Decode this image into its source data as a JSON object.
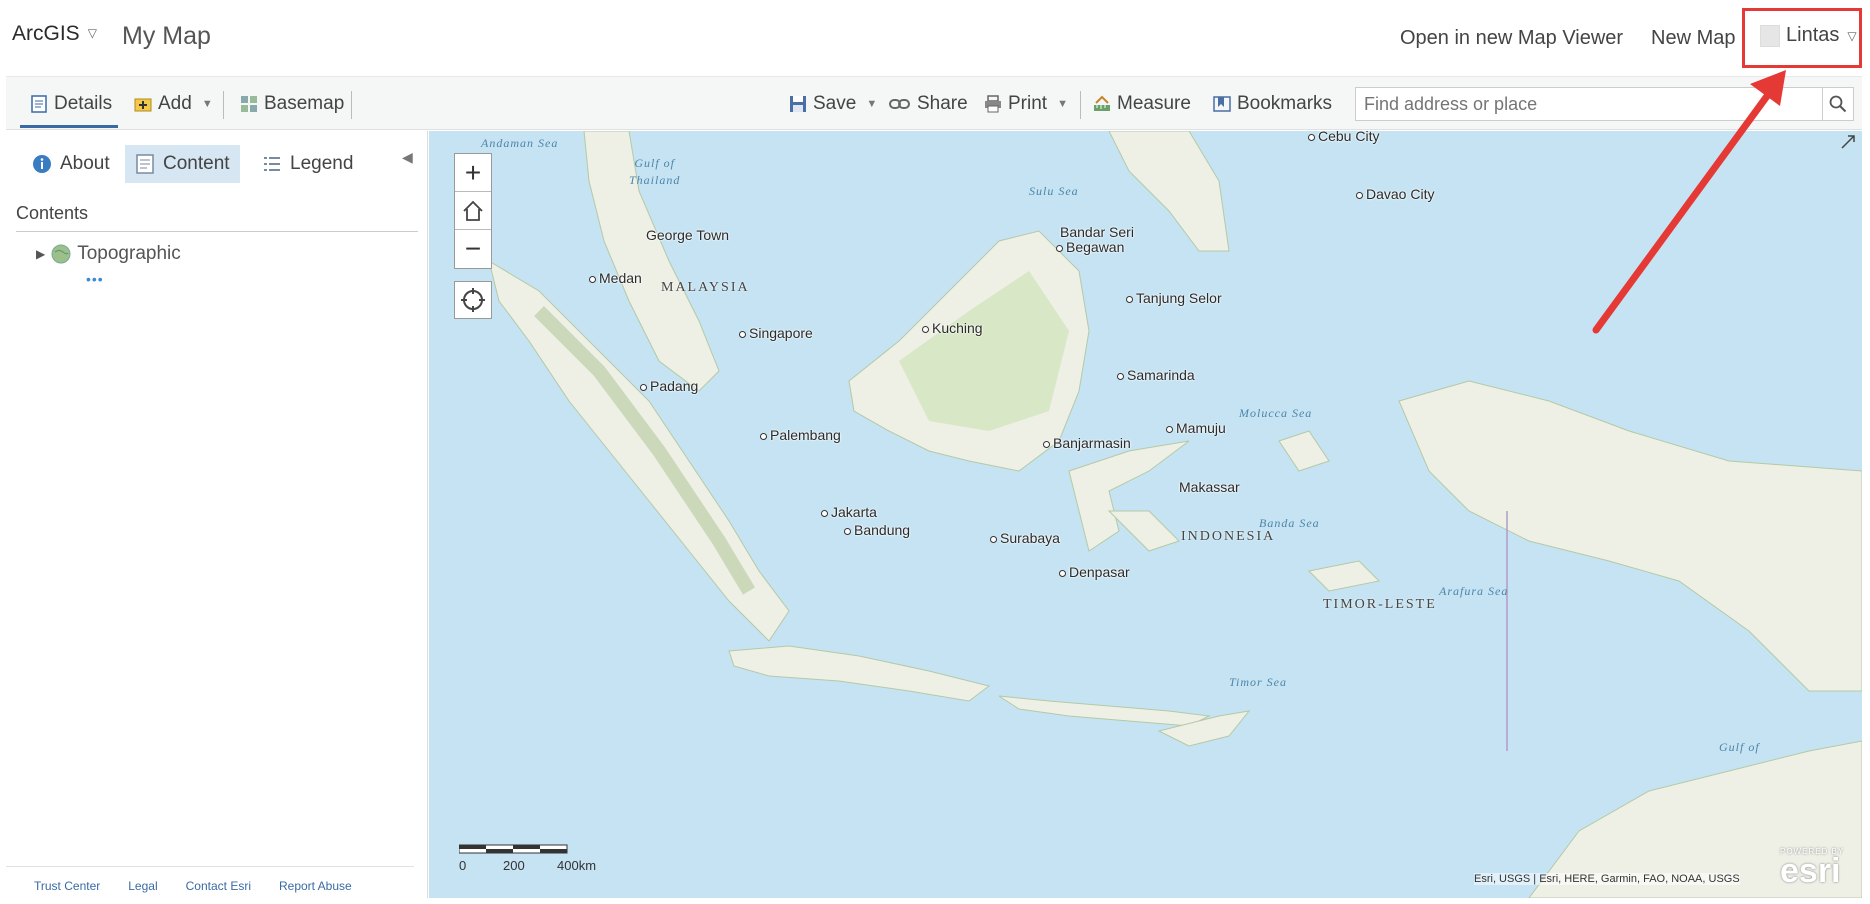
{
  "header": {
    "brand": "ArcGIS",
    "map_title": "My Map",
    "open_viewer": "Open in new Map Viewer",
    "new_map": "New Map",
    "user_name": "Lintas"
  },
  "toolbar": {
    "details": "Details",
    "add": "Add",
    "basemap": "Basemap",
    "save": "Save",
    "share": "Share",
    "print": "Print",
    "measure": "Measure",
    "bookmarks": "Bookmarks",
    "search_placeholder": "Find address or place"
  },
  "panel": {
    "tabs": {
      "about": "About",
      "content": "Content",
      "legend": "Legend"
    },
    "contents_title": "Contents",
    "layer_name": "Topographic",
    "footer": [
      "Trust Center",
      "Legal",
      "Contact Esri",
      "Report Abuse"
    ]
  },
  "map": {
    "cities": {
      "cebu": "Cebu City",
      "davao": "Davao City",
      "george_town": "George Town",
      "medan": "Medan",
      "bandar": "Bandar Seri",
      "bandar2": "Begawan",
      "tanjung": "Tanjung Selor",
      "kuching": "Kuching",
      "singapore": "Singapore",
      "padang": "Padang",
      "samarinda": "Samarinda",
      "palembang": "Palembang",
      "banjarmasin": "Banjarmasin",
      "mamuju": "Mamuju",
      "makassar": "Makassar",
      "jakarta": "Jakarta",
      "bandung": "Bandung",
      "surabaya": "Surabaya",
      "denpasar": "Denpasar"
    },
    "countries": {
      "malaysia": "MALAYSIA",
      "indonesia": "INDONESIA",
      "timor": "TIMOR-LESTE"
    },
    "seas": {
      "andaman": "Andaman Sea",
      "thailand_1": "Gulf of",
      "thailand_2": "Thailand",
      "sulu": "Sulu Sea",
      "molucca": "Molucca Sea",
      "banda": "Banda Sea",
      "arafura": "Arafura Sea",
      "timor": "Timor Sea",
      "gulf": "Gulf of"
    },
    "scale": {
      "t0": "0",
      "t1": "200",
      "t2": "400km"
    },
    "attribution": "Esri, USGS | Esri, HERE, Garmin, FAO, NOAA, USGS",
    "logo_small": "POWERED BY",
    "logo_big": "esri"
  },
  "colors": {
    "accent": "#3a6aa3",
    "highlight": "#e53935",
    "water": "#c5e3f2",
    "land": "#eef0e6",
    "forest": "#cfe2b8"
  }
}
